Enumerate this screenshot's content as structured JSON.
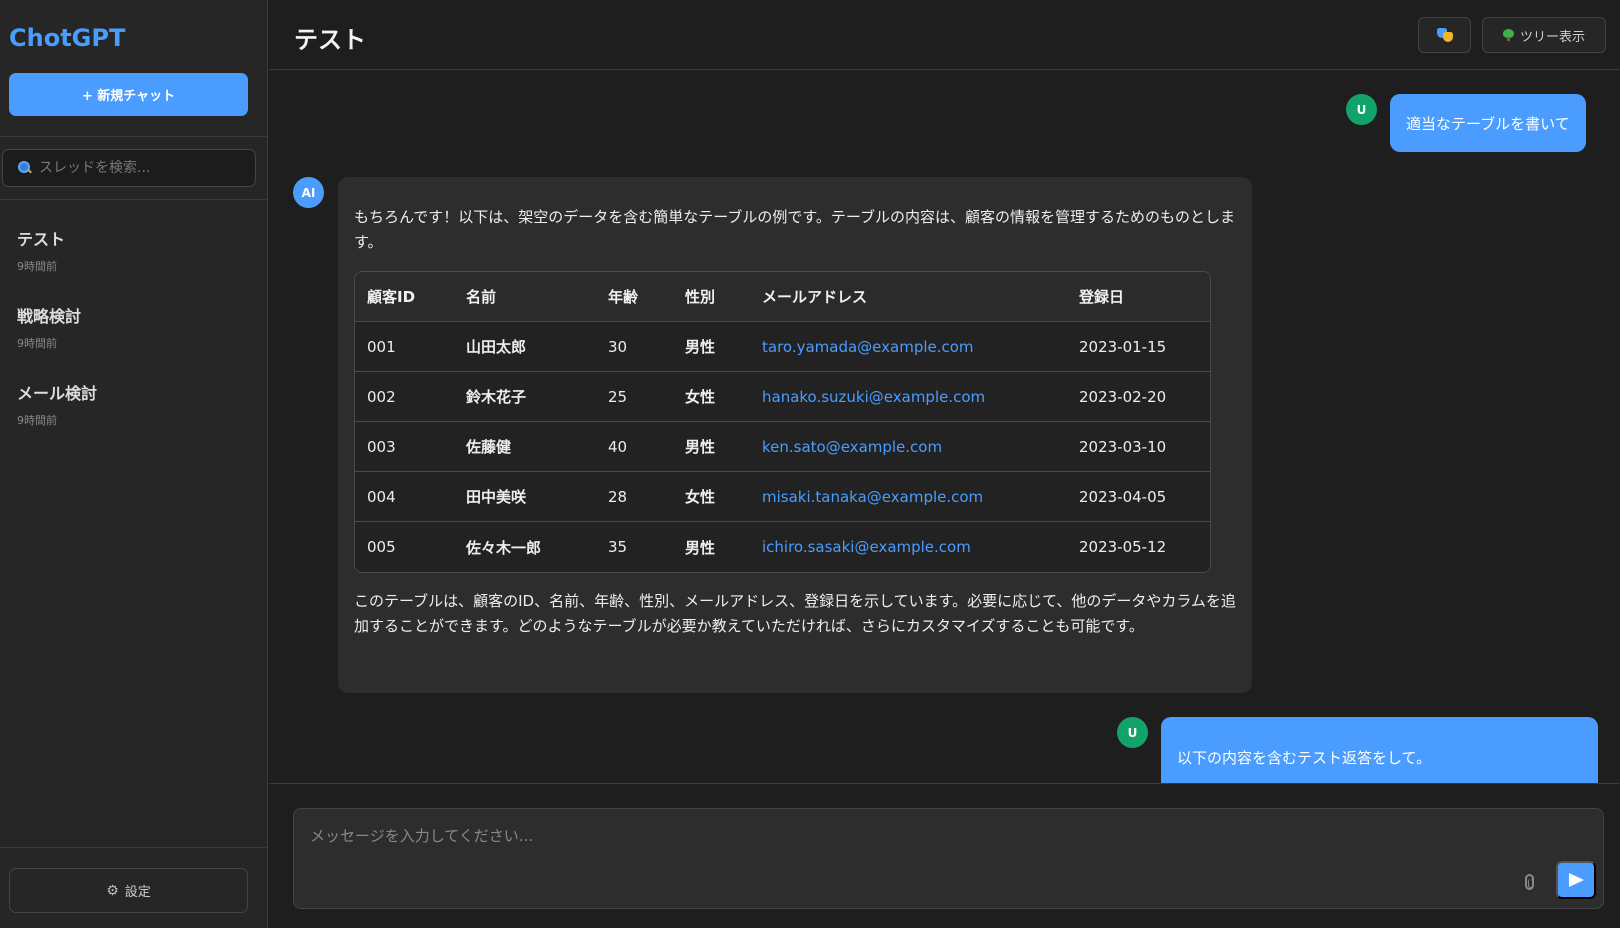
{
  "app": {
    "logo": "ChotGPT"
  },
  "sidebar": {
    "new_chat_label": "+ 新規チャット",
    "search_placeholder": "スレッドを検索...",
    "threads": [
      {
        "title": "テスト",
        "time": "9時間前"
      },
      {
        "title": "戦略検討",
        "time": "9時間前"
      },
      {
        "title": "メール検討",
        "time": "9時間前"
      }
    ],
    "settings_label": "設定"
  },
  "header": {
    "title": "テスト",
    "tree_label": "ツリー表示"
  },
  "messages": {
    "user1": {
      "avatar": "U",
      "text": "適当なテーブルを書いて"
    },
    "ai": {
      "avatar": "AI",
      "intro": "もちろんです！以下は、架空のデータを含む簡単なテーブルの例です。テーブルの内容は、顧客の情報を管理するためのものとします。",
      "outro": "このテーブルは、顧客のID、名前、年齢、性別、メールアドレス、登録日を示しています。必要に応じて、他のデータやカラムを追加することができます。どのようなテーブルが必要か教えていただければ、さらにカスタマイズすることも可能です。"
    },
    "user2": {
      "avatar": "U",
      "text": "以下の内容を含むテスト返答をして。"
    }
  },
  "table": {
    "headers": [
      "顧客ID",
      "名前",
      "年齢",
      "性別",
      "メールアドレス",
      "登録日"
    ],
    "rows": [
      [
        "001",
        "山田太郎",
        "30",
        "男性",
        "taro.yamada@example.com",
        "2023-01-15"
      ],
      [
        "002",
        "鈴木花子",
        "25",
        "女性",
        "hanako.suzuki@example.com",
        "2023-02-20"
      ],
      [
        "003",
        "佐藤健",
        "40",
        "男性",
        "ken.sato@example.com",
        "2023-03-10"
      ],
      [
        "004",
        "田中美咲",
        "28",
        "女性",
        "misaki.tanaka@example.com",
        "2023-04-05"
      ],
      [
        "005",
        "佐々木一郎",
        "35",
        "男性",
        "ichiro.sasaki@example.com",
        "2023-05-12"
      ]
    ]
  },
  "input": {
    "placeholder": "メッセージを入力してください..."
  },
  "colors": {
    "accent": "#4a9dff",
    "user_avatar": "#12a36b",
    "background": "#1e1e1e",
    "sidebar": "#262626"
  }
}
